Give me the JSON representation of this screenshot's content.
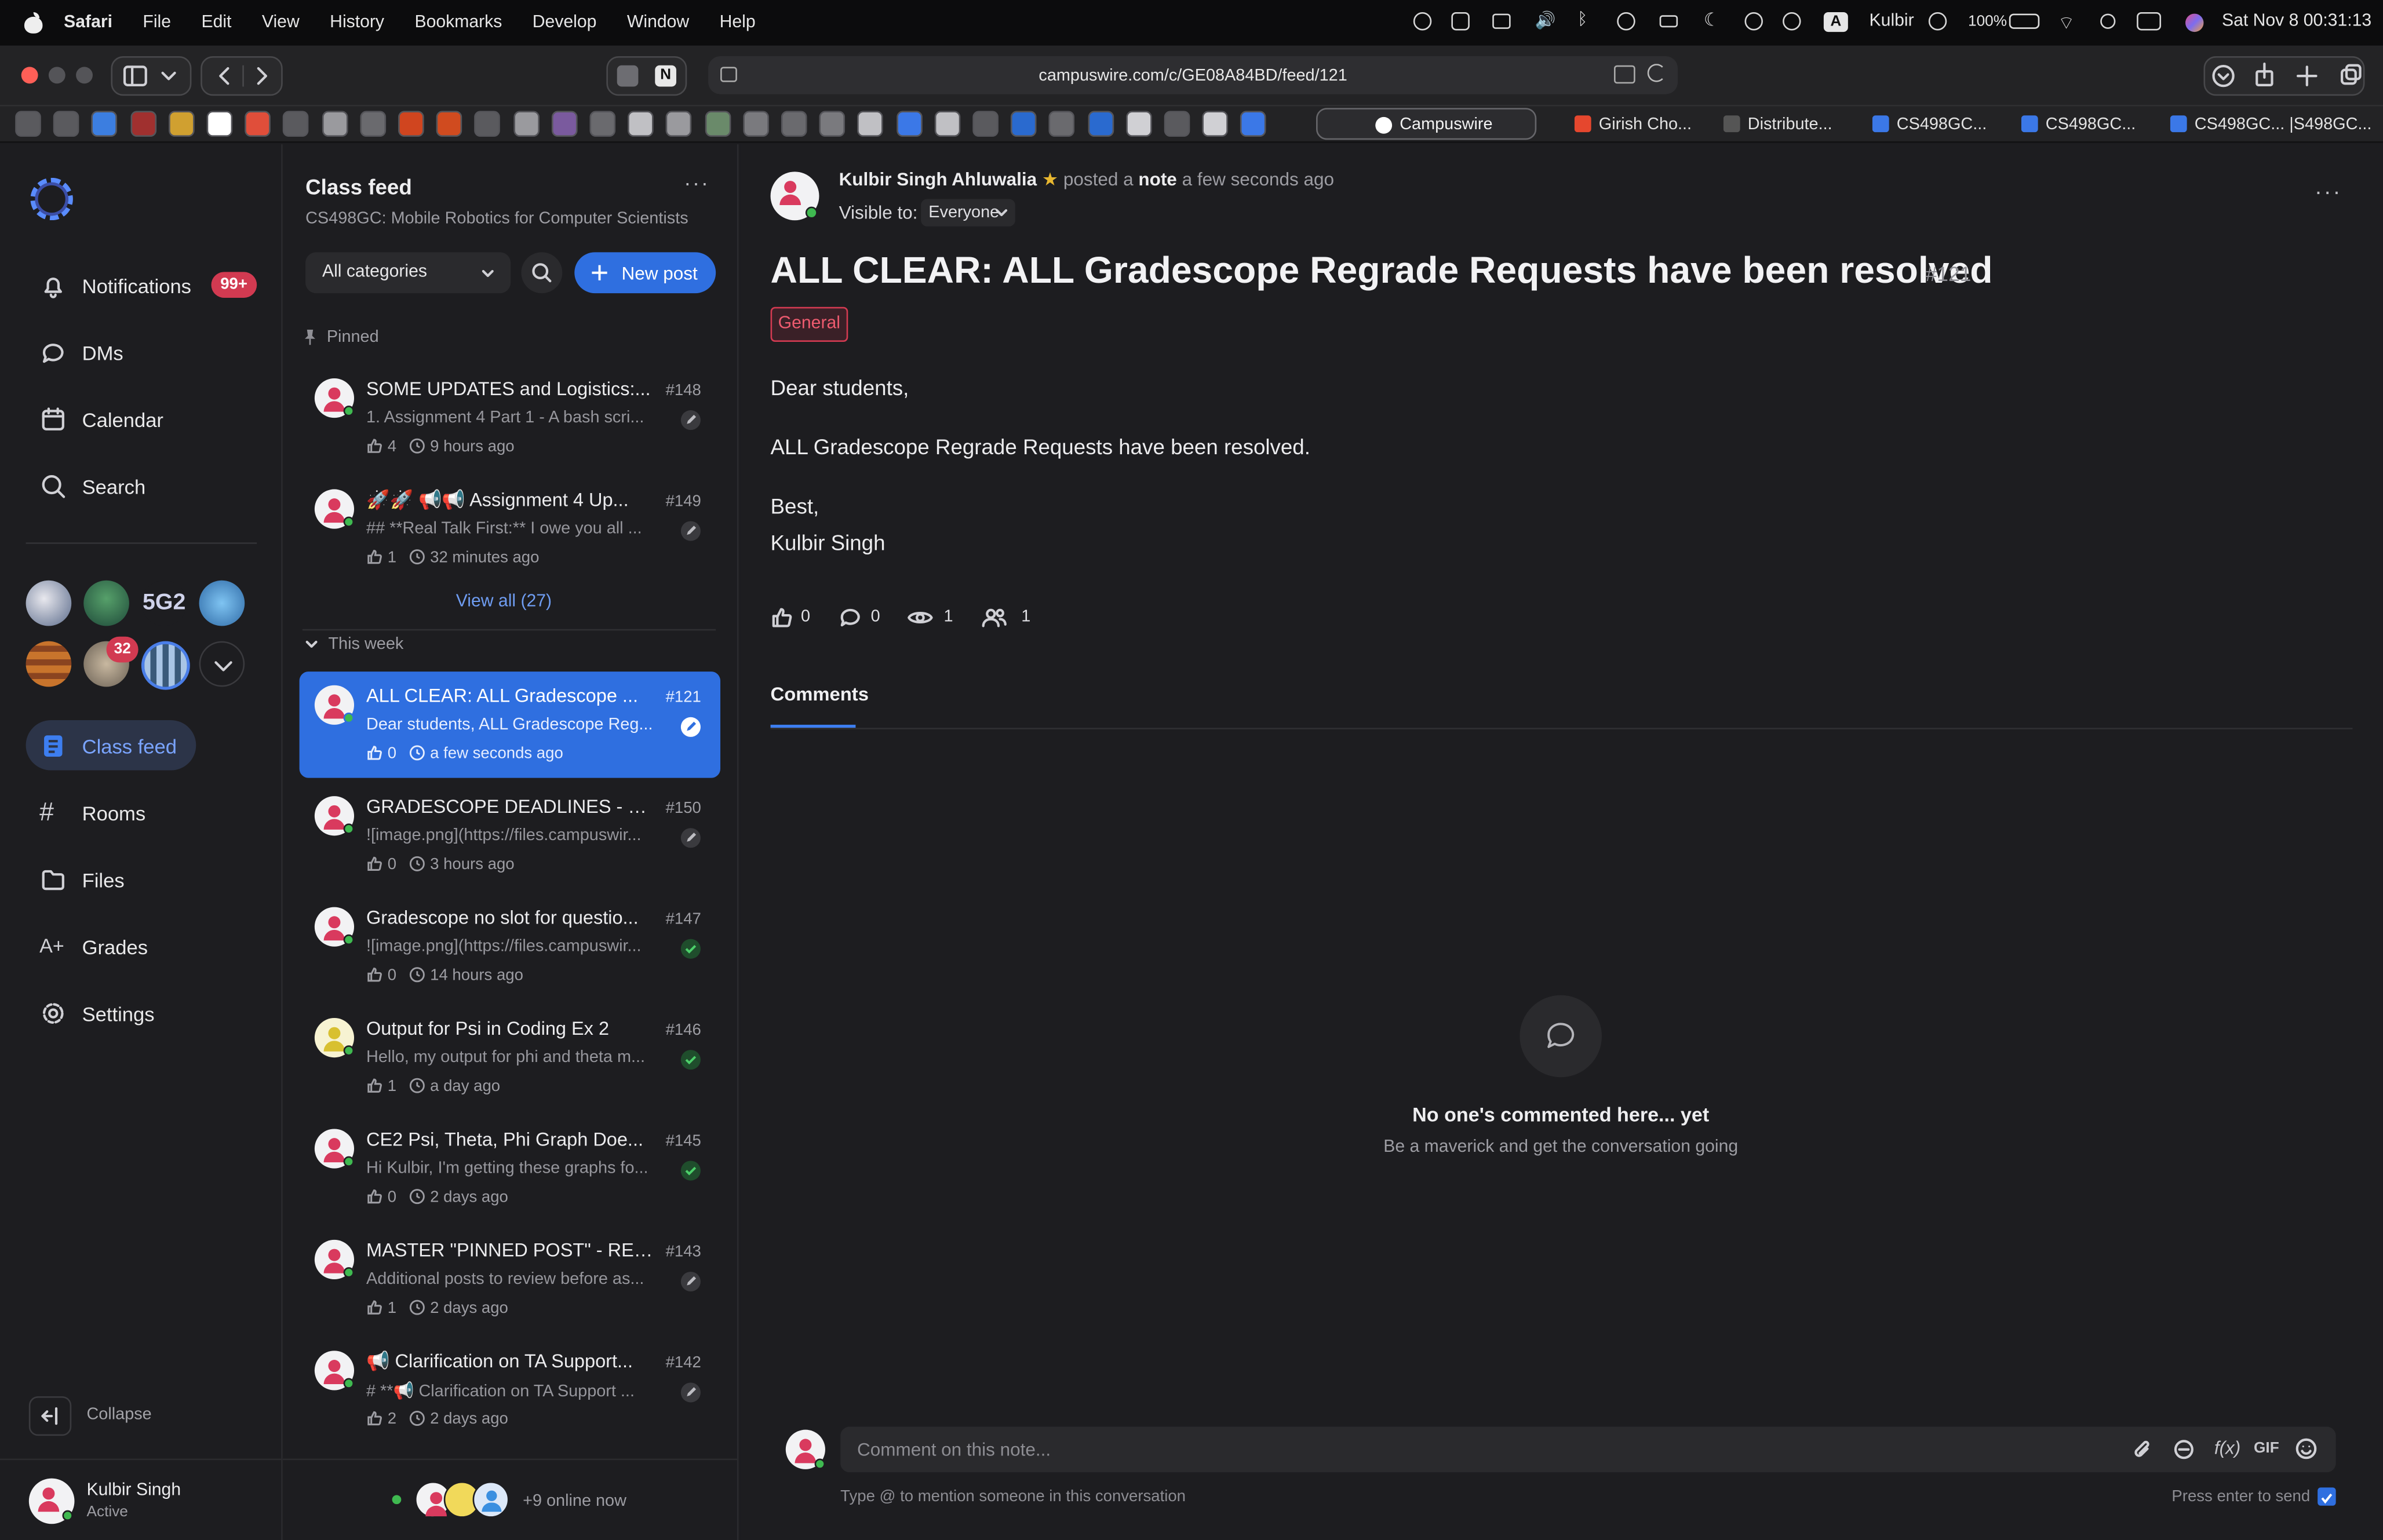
{
  "menubar": {
    "app": "Safari",
    "items": [
      "File",
      "Edit",
      "View",
      "History",
      "Bookmarks",
      "Develop",
      "Window",
      "Help"
    ],
    "user": "Kulbir",
    "battery": "100%",
    "datetime": "Sat Nov 8  00:31:13"
  },
  "browser": {
    "url": "campuswire.com/c/GE08A84BD/feed/121",
    "tabs": [
      "Campuswire",
      "Girish Cho...",
      "Distribute...",
      "CS498GC...",
      "CS498GC...",
      "CS498GC... |S498GC..."
    ]
  },
  "nav": {
    "items": [
      "Notifications",
      "DMs",
      "Calendar",
      "Search",
      "Class feed",
      "Rooms",
      "Files",
      "Grades",
      "Settings"
    ],
    "notifications_badge": "99+",
    "server_badge": "32",
    "server_label": "5G2",
    "collapse": "Collapse",
    "user_name": "Kulbir Singh",
    "user_status": "Active"
  },
  "feed": {
    "title": "Class feed",
    "subtitle": "CS498GC: Mobile Robotics for Computer Scientists",
    "category_select": "All categories",
    "new_post": "New post",
    "pinned_label": "Pinned",
    "view_all": "View all (27)",
    "week_label": "This week",
    "pinned_posts": [
      {
        "title": "SOME UPDATES and Logistics:...",
        "num": "#148",
        "preview": "1. Assignment 4 Part 1 - A bash scri...",
        "likes": "4",
        "time": "9 hours ago"
      },
      {
        "title": "🚀🚀 📢📢 Assignment 4 Up...",
        "num": "#149",
        "preview": "## **Real Talk First:** I owe you all ...",
        "likes": "1",
        "time": "32 minutes ago"
      }
    ],
    "posts": [
      {
        "title": "ALL CLEAR: ALL Gradescope ...",
        "num": "#121",
        "preview": "Dear students, ALL Gradescope Reg...",
        "likes": "0",
        "time": "a few seconds ago"
      },
      {
        "title": "GRADESCOPE DEADLINES - M...",
        "num": "#150",
        "preview": "![image.png](https://files.campuswir...",
        "likes": "0",
        "time": "3 hours ago"
      },
      {
        "title": "Gradescope no slot for questio...",
        "num": "#147",
        "preview": "![image.png](https://files.campuswir...",
        "likes": "0",
        "time": "14 hours ago"
      },
      {
        "title": "Output for Psi in Coding Ex 2",
        "num": "#146",
        "preview": "Hello, my output for phi and theta m...",
        "likes": "1",
        "time": "a day ago"
      },
      {
        "title": "CE2 Psi, Theta, Phi Graph Doe...",
        "num": "#145",
        "preview": "Hi Kulbir, I'm getting these graphs fo...",
        "likes": "0",
        "time": "2 days ago"
      },
      {
        "title": "MASTER \"PINNED POST\" - REF...",
        "num": "#143",
        "preview": "Additional posts to review before as...",
        "likes": "1",
        "time": "2 days ago"
      },
      {
        "title": "📢 Clarification on TA Support...",
        "num": "#142",
        "preview": "# **📢 Clarification on TA Support ...",
        "likes": "2",
        "time": "2 days ago"
      }
    ],
    "online": "+9 online now"
  },
  "post": {
    "author": "Kulbir Singh Ahluwalia",
    "action_pre": "posted a",
    "action_type": "note",
    "action_time": "a few seconds ago",
    "visible_label": "Visible to:",
    "visible_value": "Everyone",
    "title": "ALL CLEAR: ALL Gradescope Regrade Requests have been resolved",
    "number": "#121",
    "category": "General",
    "body": [
      "Dear students,",
      "ALL Gradescope Regrade Requests have been resolved.",
      "Best,",
      "Kulbir Singh"
    ],
    "stats": {
      "likes": "0",
      "comments": "0",
      "views": "1",
      "participants": "1"
    },
    "comments_tab": "Comments",
    "empty_title": "No one's commented here... yet",
    "empty_sub": "Be a maverick and get the conversation going",
    "comment_placeholder": "Comment on this note...",
    "mention_hint": "Type @ to mention someone in this conversation",
    "enter_hint": "Press enter to send",
    "gif": "GIF"
  },
  "colors": {
    "accent": "#2f6fe0",
    "danger": "#d23a51",
    "online": "#3fb950"
  }
}
